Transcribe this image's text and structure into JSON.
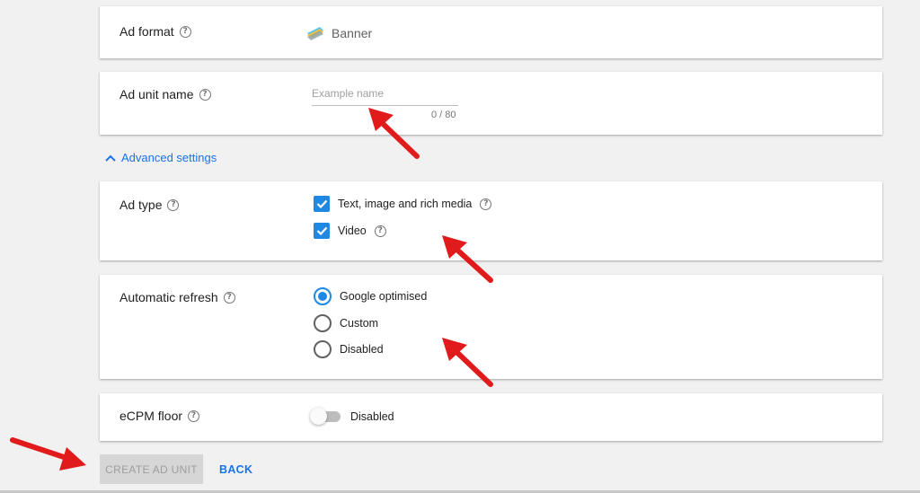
{
  "ad_format": {
    "label": "Ad format",
    "value": "Banner",
    "icon": "banner-icon"
  },
  "ad_unit_name": {
    "label": "Ad unit name",
    "placeholder": "Example name",
    "value": "",
    "counter": "0 / 80"
  },
  "advanced_settings": {
    "label": "Advanced settings",
    "expanded": true,
    "icon": "chevron-up-icon"
  },
  "ad_type": {
    "label": "Ad type",
    "options": [
      {
        "label": "Text, image and rich media",
        "checked": true,
        "has_help": true
      },
      {
        "label": "Video",
        "checked": true,
        "has_help": true
      }
    ]
  },
  "automatic_refresh": {
    "label": "Automatic refresh",
    "options": [
      {
        "label": "Google optimised",
        "selected": true
      },
      {
        "label": "Custom",
        "selected": false
      },
      {
        "label": "Disabled",
        "selected": false
      }
    ]
  },
  "ecpm_floor": {
    "label": "eCPM floor",
    "toggle_on": false,
    "toggle_label": "Disabled"
  },
  "actions": {
    "create_label": "CREATE AD UNIT",
    "create_enabled": false,
    "back_label": "BACK"
  },
  "colors": {
    "accent": "#1e88e5",
    "link": "#1a73e8",
    "annotation_arrow": "#e11b1b",
    "background": "#f1f1f1"
  }
}
